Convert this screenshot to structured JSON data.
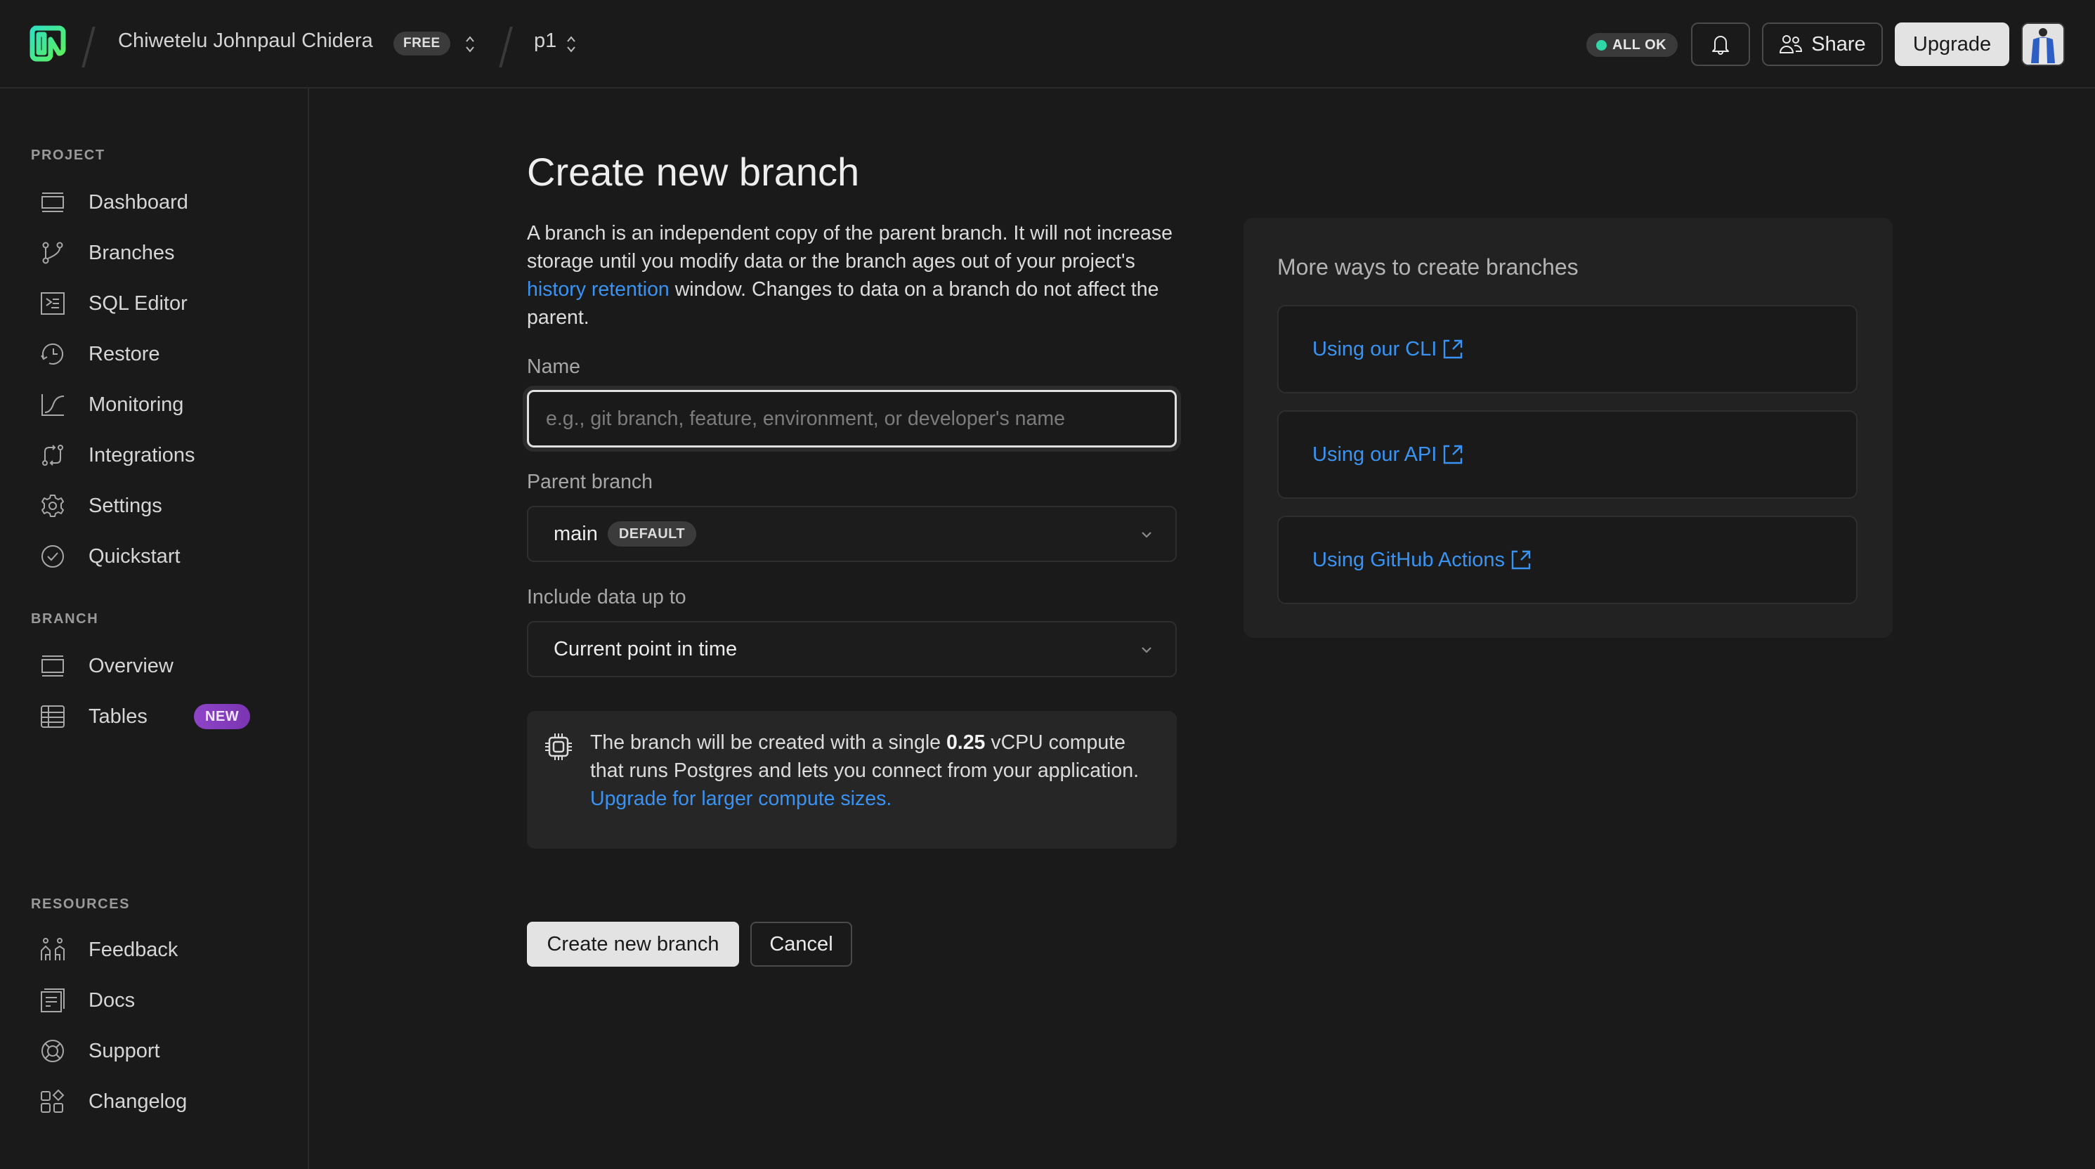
{
  "header": {
    "logo": "neon-logo",
    "org_name": "Chiwetelu Johnpaul Chidera",
    "plan_badge": "FREE",
    "project_name": "p1",
    "status_text": "ALL OK",
    "status_color": "#2fd6a6",
    "share_label": "Share",
    "upgrade_label": "Upgrade",
    "icons": {
      "notifications": "bell-icon",
      "share": "users-icon",
      "org_switch": "chevron-updown-icon",
      "project_switch": "chevron-updown-icon"
    }
  },
  "sidebar": {
    "sections": [
      {
        "label": "PROJECT",
        "items": [
          {
            "label": "Dashboard",
            "icon": "dashboard-icon"
          },
          {
            "label": "Branches",
            "icon": "git-branch-icon"
          },
          {
            "label": "SQL Editor",
            "icon": "terminal-icon"
          },
          {
            "label": "Restore",
            "icon": "history-icon"
          },
          {
            "label": "Monitoring",
            "icon": "chart-line-icon"
          },
          {
            "label": "Integrations",
            "icon": "integrations-icon"
          },
          {
            "label": "Settings",
            "icon": "gear-icon"
          },
          {
            "label": "Quickstart",
            "icon": "check-circle-icon"
          }
        ]
      },
      {
        "label": "BRANCH",
        "items": [
          {
            "label": "Overview",
            "icon": "overview-icon"
          },
          {
            "label": "Tables",
            "icon": "table-icon",
            "badge": "NEW",
            "badge_color": "#8e44c7"
          }
        ]
      },
      {
        "label": "RESOURCES",
        "items": [
          {
            "label": "Feedback",
            "icon": "feedback-icon"
          },
          {
            "label": "Docs",
            "icon": "docs-icon"
          },
          {
            "label": "Support",
            "icon": "lifebuoy-icon"
          },
          {
            "label": "Changelog",
            "icon": "changelog-icon"
          }
        ]
      }
    ]
  },
  "main": {
    "title": "Create new branch",
    "intro": {
      "before_link": "A branch is an independent copy of the parent branch. It will not increase storage until you modify data or the branch ages out of your project's ",
      "link": "history retention",
      "after_link": " window. Changes to data on a branch do not affect the parent."
    },
    "name_field": {
      "label": "Name",
      "value": "",
      "placeholder": "e.g., git branch, feature, environment, or developer's name"
    },
    "parent_branch": {
      "label": "Parent branch",
      "value": "main",
      "badge": "DEFAULT"
    },
    "include_data": {
      "label": "Include data up to",
      "value": "Current point in time"
    },
    "info": {
      "icon": "cpu-icon",
      "text_before": "The branch will be created with a single ",
      "bold": "0.25",
      "text_after": " vCPU compute that runs Postgres and lets you connect from your application. ",
      "link": "Upgrade for larger compute sizes."
    },
    "create_label": "Create new branch",
    "cancel_label": "Cancel",
    "link_color": "#3a93f2"
  },
  "side_panel": {
    "title": "More ways to create branches",
    "ways": [
      {
        "label": "Using our CLI",
        "icon": "external-link-icon"
      },
      {
        "label": "Using our API",
        "icon": "external-link-icon"
      },
      {
        "label": "Using GitHub Actions",
        "icon": "external-link-icon"
      }
    ]
  }
}
